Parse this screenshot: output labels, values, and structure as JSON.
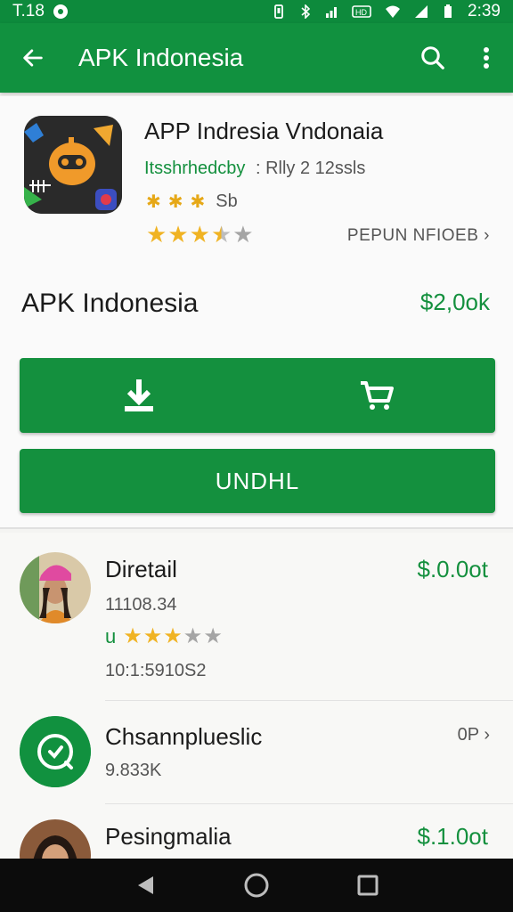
{
  "status_bar": {
    "time_left": "T.18",
    "time_right": "2:39"
  },
  "app_bar": {
    "title": "APK Indonesia",
    "back_icon": "arrow-back-icon",
    "search_icon": "search-icon",
    "more_icon": "more-vert-icon"
  },
  "app_card": {
    "name": "APP Indresia Vndonaia",
    "developer": "Itsshrhedcby",
    "meta": ": Rlly 2 12ssls",
    "mini_rating_text": "Sb",
    "rating": 3.5,
    "more_link": "PEPUN NFIOEB",
    "subtitle": "APK Indonesia",
    "price": "$2,0ok",
    "install_label": "UNDHL"
  },
  "list": {
    "items": [
      {
        "title": "Diretail",
        "sub": "11108.34",
        "rating_prefix": "u",
        "rating": 3.0,
        "sub2": "10:1:5910S2",
        "price": "$.0.0ot"
      },
      {
        "title": "Chsannplueslic",
        "sub": "9.833K",
        "side": "0P"
      },
      {
        "title": "Pesingmalia",
        "price": "$.1.0ot"
      }
    ]
  },
  "colors": {
    "brand_green": "#11913f",
    "price_green": "#14903e",
    "star": "#f0b323"
  }
}
